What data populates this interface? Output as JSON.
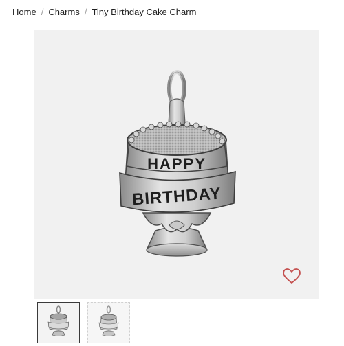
{
  "breadcrumb": {
    "items": [
      {
        "label": "Home"
      },
      {
        "label": "Charms"
      }
    ],
    "separator": "/",
    "current": "Tiny Birthday Cake Charm"
  },
  "product": {
    "charm_text_top": "HAPPY",
    "charm_text_bottom": "BIRTHDAY"
  },
  "icons": {
    "wishlist": "heart-outline-icon"
  },
  "colors": {
    "accent": "#c4504f",
    "image_bg": "#f1f1f1"
  },
  "gallery": {
    "thumbnail_count": 2,
    "selected_index": 0
  }
}
